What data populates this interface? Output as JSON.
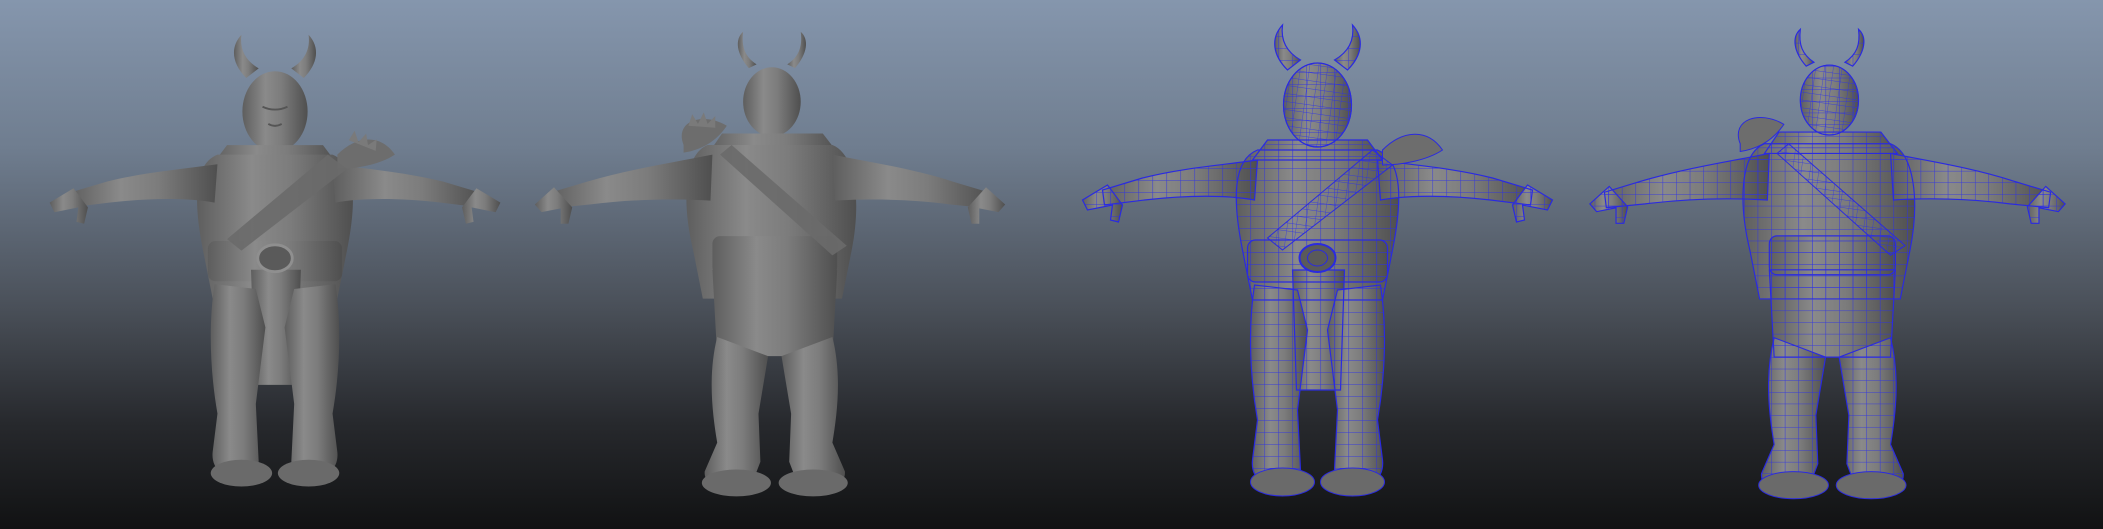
{
  "scene": {
    "views": [
      {
        "id": "front-shaded",
        "shading": "smooth"
      },
      {
        "id": "back-shaded",
        "shading": "smooth"
      },
      {
        "id": "front-wireframe",
        "shading": "wireframe-on-shaded"
      },
      {
        "id": "back-wireframe",
        "shading": "wireframe-on-shaded"
      }
    ]
  },
  "colors": {
    "sky_top": "#8596ad",
    "floor_bottom": "#111213",
    "clay": "#7a7a7a",
    "wire": "#2a2ae0"
  }
}
